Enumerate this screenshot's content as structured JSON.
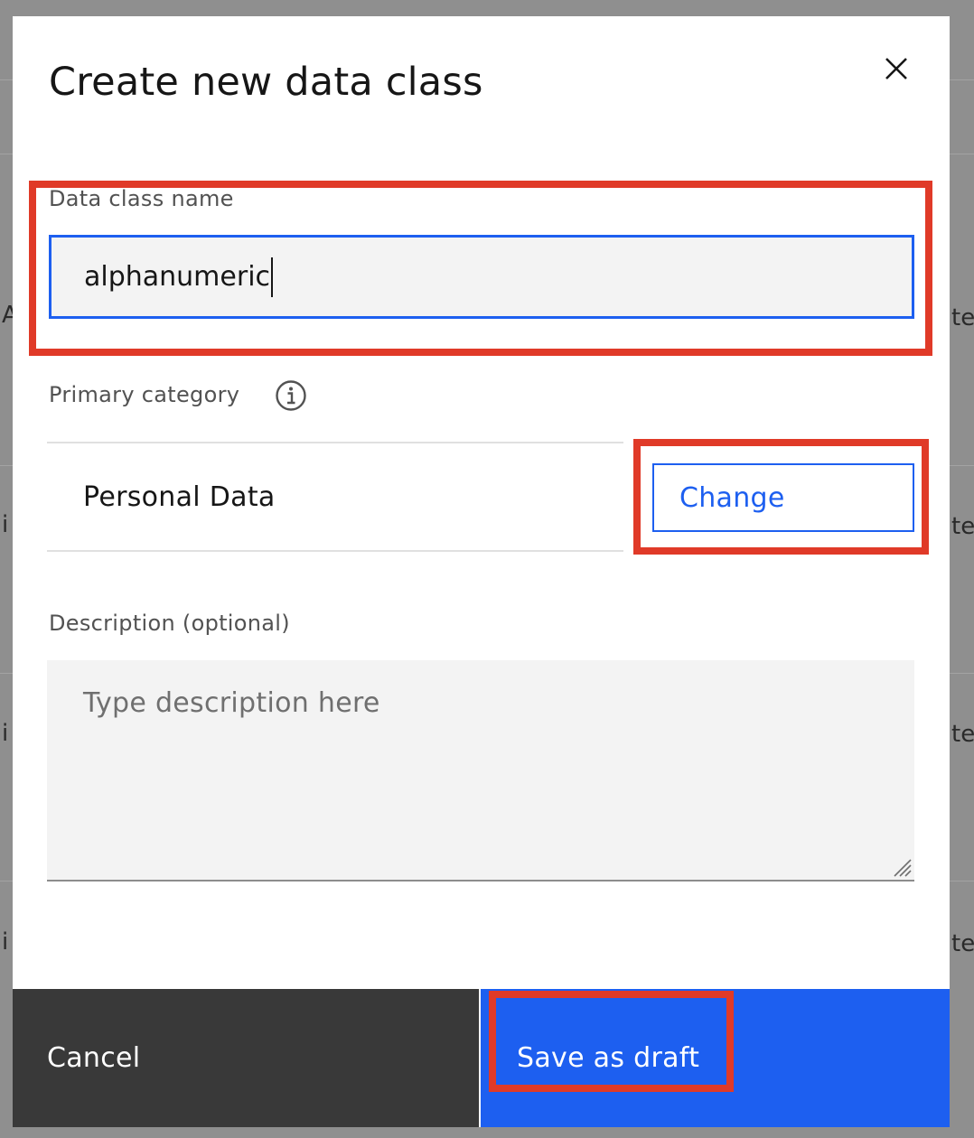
{
  "modal": {
    "title": "Create new data class",
    "name_field": {
      "label": "Data class name",
      "value": "alphanumeric"
    },
    "category": {
      "label": "Primary category",
      "value": "Personal Data",
      "change_label": "Change"
    },
    "description": {
      "label": "Description (optional)",
      "placeholder": "Type description here",
      "value": ""
    },
    "footer": {
      "cancel_label": "Cancel",
      "save_label": "Save as draft"
    }
  },
  "background_fragments": {
    "left": [
      "A",
      "i",
      "i",
      "i"
    ],
    "right": [
      "te",
      "te",
      "te",
      "te"
    ]
  },
  "icons": {
    "close": "close-icon",
    "info": "info-icon",
    "resize": "resize-handle-icon"
  },
  "colors": {
    "primary": "#1d5ff0",
    "secondary_button": "#393939",
    "annotation": "#e03a28",
    "field_background": "#f3f3f3"
  }
}
